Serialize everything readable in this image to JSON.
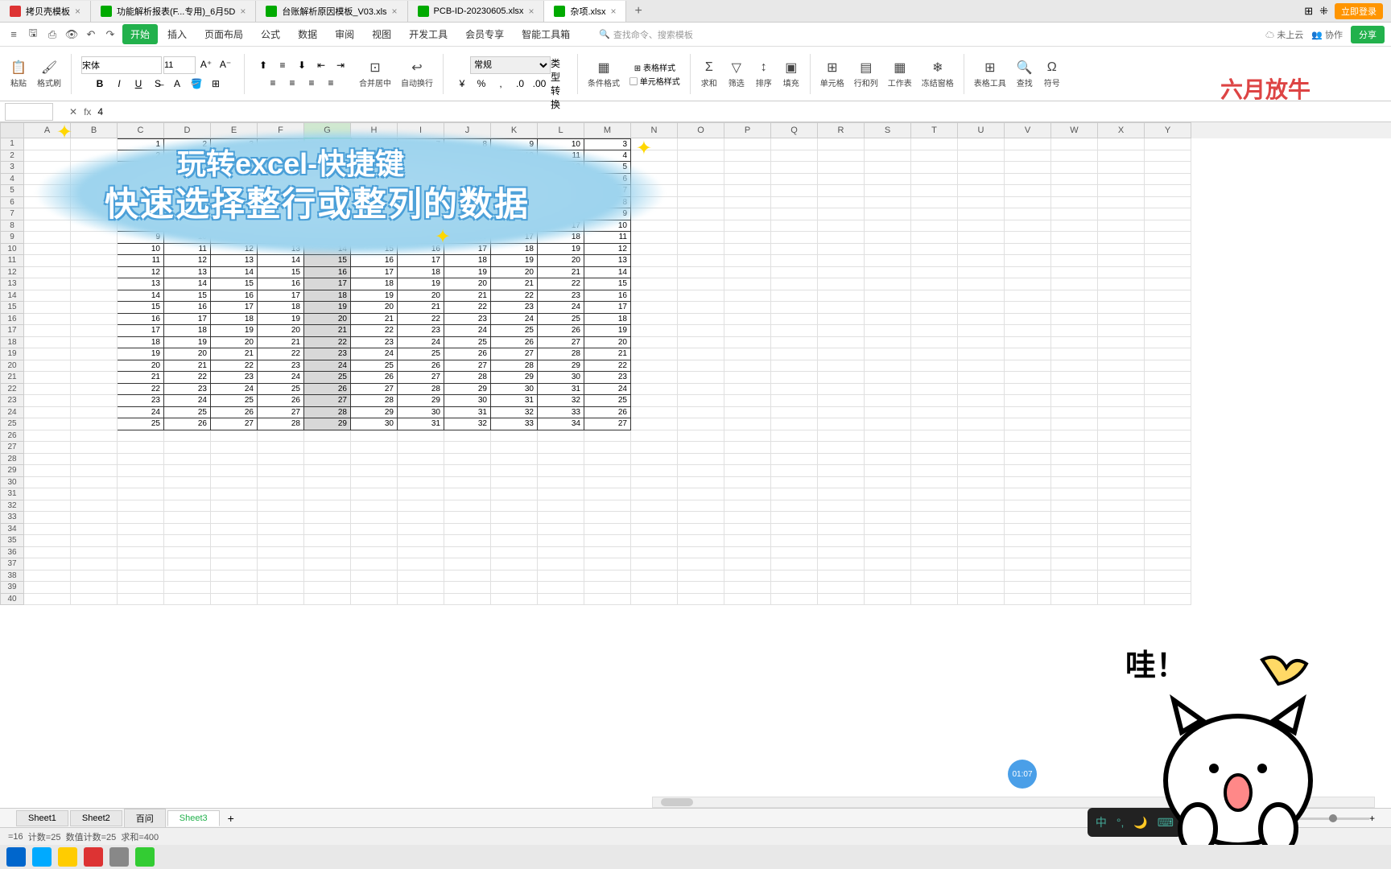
{
  "tabs": [
    {
      "label": "拷贝壳模板",
      "icon": "red"
    },
    {
      "label": "功能解析报表(F...专用)_6月5D",
      "icon": "green"
    },
    {
      "label": "台账解析原因模板_V03.xls",
      "icon": "green"
    },
    {
      "label": "PCB-ID-20230605.xlsx",
      "icon": "green"
    },
    {
      "label": "杂项.xlsx",
      "icon": "green",
      "active": true
    }
  ],
  "login_label": "立即登录",
  "ribbon_tabs": [
    "开始",
    "插入",
    "页面布局",
    "公式",
    "数据",
    "审阅",
    "视图",
    "开发工具",
    "会员专享",
    "智能工具箱"
  ],
  "search_placeholder": "查找命令、搜索模板",
  "cloud_status": "未上云",
  "collab": "协作",
  "share": "分享",
  "font": {
    "name": "宋体",
    "size": "11"
  },
  "ribbon_buttons": {
    "paste": "粘贴",
    "format_painter": "格式刷",
    "merge": "合并居中",
    "wrap": "自动换行",
    "number_format": "常规",
    "type_convert": "类型转换",
    "cond_format": "条件格式",
    "table_style": "表格样式",
    "cell_style": "单元格样式",
    "sum": "求和",
    "filter": "筛选",
    "sort": "排序",
    "fill": "填充",
    "cells": "单元格",
    "rows_cols": "行和列",
    "worksheet": "工作表",
    "freeze": "冻结窗格",
    "table_tools": "表格工具",
    "find": "查找",
    "symbol": "符号"
  },
  "watermark": "六月放牛",
  "formula_value": "4",
  "name_box": "",
  "columns": [
    "A",
    "B",
    "C",
    "D",
    "E",
    "F",
    "G",
    "H",
    "I",
    "J",
    "K",
    "L",
    "M",
    "N",
    "O",
    "P",
    "Q",
    "R",
    "S",
    "T",
    "U",
    "V",
    "W",
    "X",
    "Y"
  ],
  "selected_col": "G",
  "active_cell": "G4",
  "data_start_row": 1,
  "data_rows": 25,
  "data_cols": 11,
  "data_offset_col": 3,
  "chart_data": {
    "type": "table",
    "description": "25x11 numeric grid where cell(r,c)=r+c for r=1..25, c=0..10",
    "sample_first_row": [
      1,
      2,
      3,
      4,
      5,
      6,
      7,
      8,
      9,
      10,
      3
    ],
    "sample_last_row": [
      25,
      26,
      27,
      28,
      29,
      30,
      31,
      32,
      33,
      34,
      27
    ],
    "note": "last column values equal r+2"
  },
  "overlay": {
    "line1": "玩转excel-快捷键",
    "line2": "快速选择整行或整列的数据"
  },
  "sheet_tabs": [
    "Sheet1",
    "Sheet2",
    "百问",
    "Sheet3"
  ],
  "active_sheet": "Sheet3",
  "status": {
    "avg": "=16",
    "count": "计数=25",
    "num_count": "数值计数=25",
    "sum": "求和=400"
  },
  "timestamp": "01:07",
  "ime": "中",
  "cat_text": "哇！"
}
